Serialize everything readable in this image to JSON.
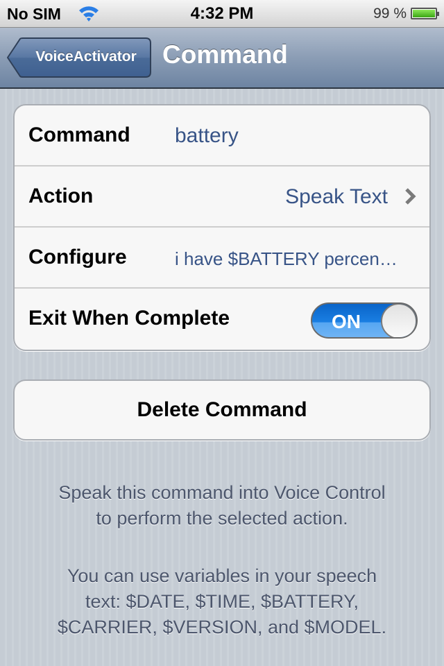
{
  "status_bar": {
    "carrier": "No SIM",
    "wifi_icon": "wifi-icon",
    "time": "4:32 PM",
    "battery_percent_label": "99 %",
    "battery_level": 0.99
  },
  "nav_bar": {
    "back_label": "VoiceActivator",
    "title": "Command"
  },
  "settings": {
    "rows": [
      {
        "label": "Command",
        "value": "battery"
      },
      {
        "label": "Action",
        "value": "Speak Text",
        "accessory": "chevron-right-icon"
      },
      {
        "label": "Configure",
        "value": "i have $BATTERY percen…"
      },
      {
        "label": "Exit When Complete",
        "toggle_state": "ON",
        "toggle_on": true
      }
    ]
  },
  "delete_button": {
    "label": "Delete Command"
  },
  "footer": {
    "lines_1": [
      "Speak this command into Voice Control",
      "to perform the selected action."
    ],
    "lines_2": [
      "You can use variables in your speech",
      "text: $DATE, $TIME, $BATTERY,",
      "$CARRIER, $VERSION, and $MODEL."
    ]
  },
  "colors": {
    "value_text": "#385487",
    "toggle_on": "#1a7fe3",
    "nav_bar": "#8b9db5",
    "background": "#c5ccd4"
  }
}
